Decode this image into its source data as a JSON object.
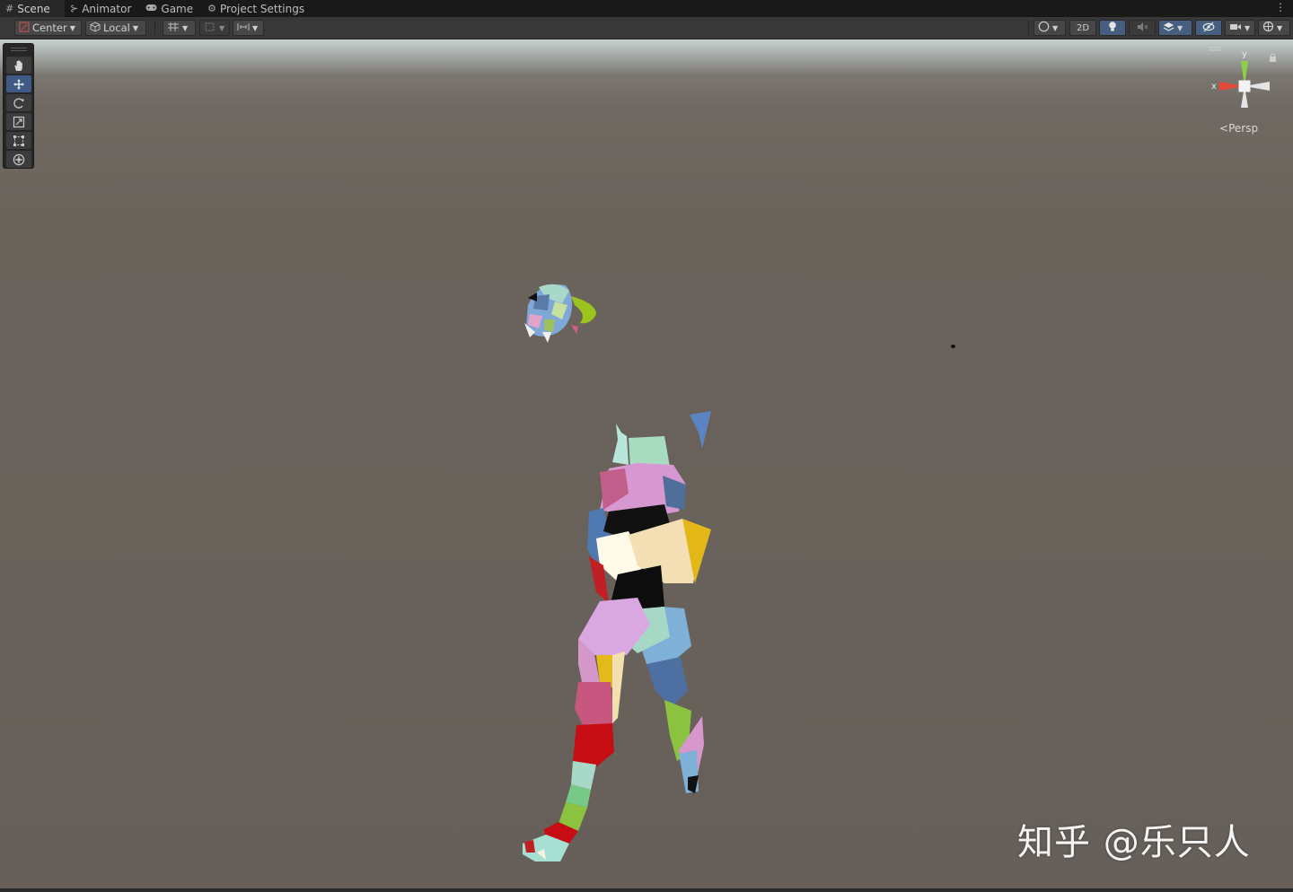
{
  "tabs": [
    {
      "icon": "grid-icon",
      "label": "Scene",
      "active": true
    },
    {
      "icon": "animator-icon",
      "label": "Animator",
      "active": false
    },
    {
      "icon": "gamepad-icon",
      "label": "Game",
      "active": false
    },
    {
      "icon": "gear-icon",
      "label": "Project Settings",
      "active": false
    }
  ],
  "toolbar": {
    "pivot_label": "Center",
    "space_label": "Local",
    "mode_2d_label": "2D"
  },
  "gizmo": {
    "x_label": "x",
    "y_label": "y",
    "projection_label": "Persp",
    "colors": {
      "x": "#e5493a",
      "y": "#8cd146",
      "neutral": "#e8e8e8"
    }
  },
  "watermark": "知乎 @乐只人",
  "colors": {
    "accent": "#465f80",
    "tabbar_bg": "#191919",
    "toolbar_bg": "#383838",
    "viewport_bg": "#67605a"
  }
}
